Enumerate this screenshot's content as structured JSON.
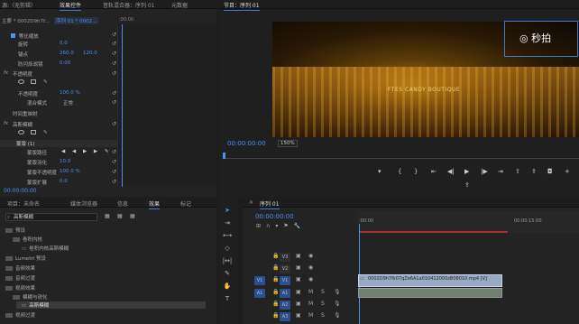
{
  "source_panel": {
    "tab0": "源:（无剪辑）",
    "tab1": "效果控件",
    "tab2": "音轨混合器：序列 01",
    "tab3": "元数据"
  },
  "effect_controls": {
    "master": "主要 * 0002D9h7f...",
    "seq": "序列 01 * 0002...",
    "mini_time": ":00:00",
    "uniform_scale": "等比缩放",
    "rows": [
      {
        "label": "旋转",
        "value": "0.0"
      },
      {
        "label": "锚点",
        "value": "260.0",
        "value2": "120.0"
      },
      {
        "label": "防闪烁滤镜",
        "value": "0.00"
      },
      {
        "label": "不透明度",
        "value": ""
      },
      {
        "label": "不透明度",
        "value": "100.0 %"
      },
      {
        "label": "混合模式",
        "value": "正常"
      },
      {
        "label": "时间重映射",
        "value": ""
      },
      {
        "label": "高斯模糊",
        "value": ""
      },
      {
        "label": "蒙版 (1)",
        "value": ""
      },
      {
        "label": "蒙版路径",
        "value": ""
      },
      {
        "label": "蒙版羽化",
        "value": "10.0"
      },
      {
        "label": "蒙版不透明度",
        "value": "100.0 %"
      },
      {
        "label": "蒙版扩展",
        "value": "0.0"
      }
    ],
    "fx": "fx",
    "timecode": "00:00:00:00"
  },
  "program": {
    "tab": "节目：序列 01",
    "timecode": "00:00:00:00",
    "zoom": "150%",
    "video_caption": "FTES CANDY BOUTIQUE",
    "watermark": "秒拍"
  },
  "project": {
    "tabs": [
      "项目：未命名",
      "媒体浏览器",
      "信息",
      "效果",
      "标记"
    ],
    "search_value": "高斯模糊",
    "items": [
      "预设",
      "卷积内核",
      "卷积内核高斯模糊",
      "Lumetri 预设",
      "音频效果",
      "音频过渡",
      "视频效果",
      "模糊与锐化",
      "高斯模糊",
      "视频过渡"
    ]
  },
  "timeline": {
    "tab": "序列 01",
    "timecode": "00:00:00:00",
    "ruler0": ":00:00",
    "ruler1": "00:00:15:00",
    "tracks": [
      "V3",
      "V2",
      "V1",
      "A1",
      "A2",
      "A3"
    ],
    "src_v": "V1",
    "src_a": "A1",
    "clip": "0002D9h7fk07qZe6A1a010412000zB08010.mp4 [V]"
  },
  "colors": {
    "accent": "#3d78d8",
    "timecode": "#4f8ff0",
    "clip": "#9aa8c8",
    "playhead": "#4f8ff0"
  }
}
